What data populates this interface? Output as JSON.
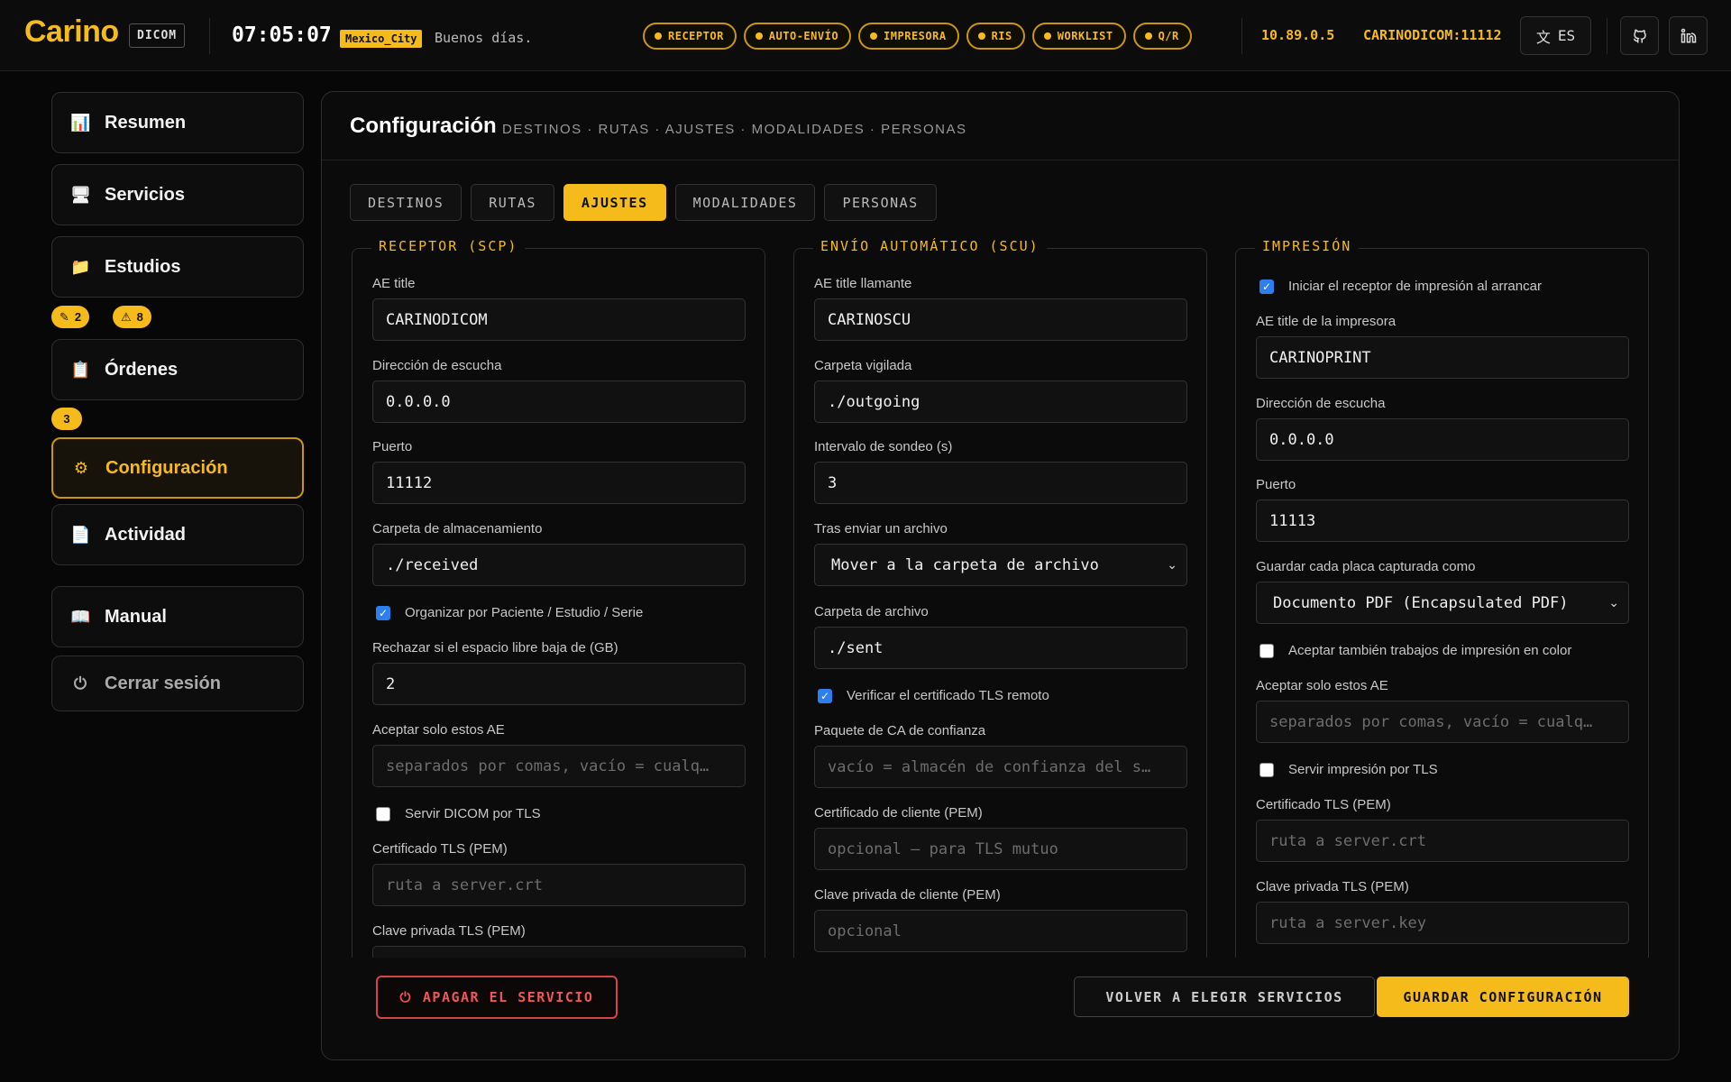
{
  "colors": {
    "accent": "#f4bb1a",
    "danger": "#d64545",
    "background": "#070707"
  },
  "header": {
    "logo": "Carino",
    "badge": "DICOM",
    "clock": "07:05:07",
    "timezone": "Mexico_City",
    "greeting": "Buenos días.",
    "services": [
      "RECEPTOR",
      "AUTO-ENVÍO",
      "IMPRESORA",
      "RIS",
      "WORKLIST",
      "Q/R"
    ],
    "ip": "10.89.0.5",
    "ae_port": "CARINODICOM:11112",
    "lang": "ES",
    "lang_icon": "translate-icon",
    "github_icon": "github-icon",
    "linkedin_icon": "linkedin-icon"
  },
  "sidebar": {
    "items": [
      {
        "label": "Resumen",
        "icon": "📊"
      },
      {
        "label": "Servicios",
        "icon": "🖥"
      },
      {
        "label": "Estudios",
        "icon": "📁"
      },
      {
        "label": "Órdenes",
        "icon": "📋"
      },
      {
        "label": "Configuración",
        "icon": "⚙"
      },
      {
        "label": "Actividad",
        "icon": "📄"
      },
      {
        "label": "Manual",
        "icon": "📖"
      },
      {
        "label": "Cerrar sesión",
        "icon": "⏻"
      }
    ],
    "estudios_badges": [
      {
        "icon": "✎",
        "count": "2"
      },
      {
        "icon": "⚠",
        "count": "8"
      }
    ],
    "ordenes_badge": "3"
  },
  "main": {
    "title": "Configuración",
    "subtitle": "DESTINOS · RUTAS · AJUSTES · MODALIDADES · PERSONAS",
    "tabs": [
      "DESTINOS",
      "RUTAS",
      "AJUSTES",
      "MODALIDADES",
      "PERSONAS"
    ],
    "active_tab": "AJUSTES",
    "receptor": {
      "legend": "RECEPTOR (SCP)",
      "ae_title_label": "AE title",
      "ae_title": "CARINODICOM",
      "listen_label": "Dirección de escucha",
      "listen": "0.0.0.0",
      "port_label": "Puerto",
      "port": "11112",
      "storage_label": "Carpeta de almacenamiento",
      "storage": "./received",
      "organize_label": "Organizar por Paciente / Estudio / Serie",
      "reject_label": "Rechazar si el espacio libre baja de (GB)",
      "reject": "2",
      "accept_label": "Aceptar solo estos AE",
      "accept_placeholder": "separados por comas, vacío = cualq…",
      "tls_label": "Servir DICOM por TLS",
      "cert_label": "Certificado TLS (PEM)",
      "cert_placeholder": "ruta a server.crt",
      "key_label": "Clave privada TLS (PEM)"
    },
    "envio": {
      "legend": "ENVÍO AUTOMÁTICO (SCU)",
      "ae_label": "AE title llamante",
      "ae": "CARINOSCU",
      "watch_label": "Carpeta vigilada",
      "watch": "./outgoing",
      "poll_label": "Intervalo de sondeo (s)",
      "poll": "3",
      "after_label": "Tras enviar un archivo",
      "after": "Mover a la carpeta de archivo",
      "archive_label": "Carpeta de archivo",
      "archive": "./sent",
      "verify_label": "Verificar el certificado TLS remoto",
      "ca_label": "Paquete de CA de confianza",
      "ca_placeholder": "vacío = almacén de confianza del s…",
      "client_cert_label": "Certificado de cliente (PEM)",
      "client_cert_placeholder": "opcional — para TLS mutuo",
      "client_key_label": "Clave privada de cliente (PEM)",
      "client_key_placeholder": "opcional"
    },
    "impresion": {
      "legend": "IMPRESIÓN",
      "autostart_label": "Iniciar el receptor de impresión al arrancar",
      "ae_label": "AE title de la impresora",
      "ae": "CARINOPRINT",
      "listen_label": "Dirección de escucha",
      "listen": "0.0.0.0",
      "port_label": "Puerto",
      "port": "11113",
      "save_label": "Guardar cada placa capturada como",
      "save": "Documento PDF (Encapsulated PDF)",
      "color_label": "Aceptar también trabajos de impresión en color",
      "accept_label": "Aceptar solo estos AE",
      "accept_placeholder": "separados por comas, vacío = cualq…",
      "tls_label": "Servir impresión por TLS",
      "cert_label": "Certificado TLS (PEM)",
      "cert_placeholder": "ruta a server.crt",
      "key_label": "Clave privada TLS (PEM)",
      "key_placeholder": "ruta a server.key"
    },
    "buttons": {
      "shutdown": "APAGAR EL SERVICIO",
      "back": "VOLVER A ELEGIR SERVICIOS",
      "save": "GUARDAR CONFIGURACIÓN"
    }
  }
}
